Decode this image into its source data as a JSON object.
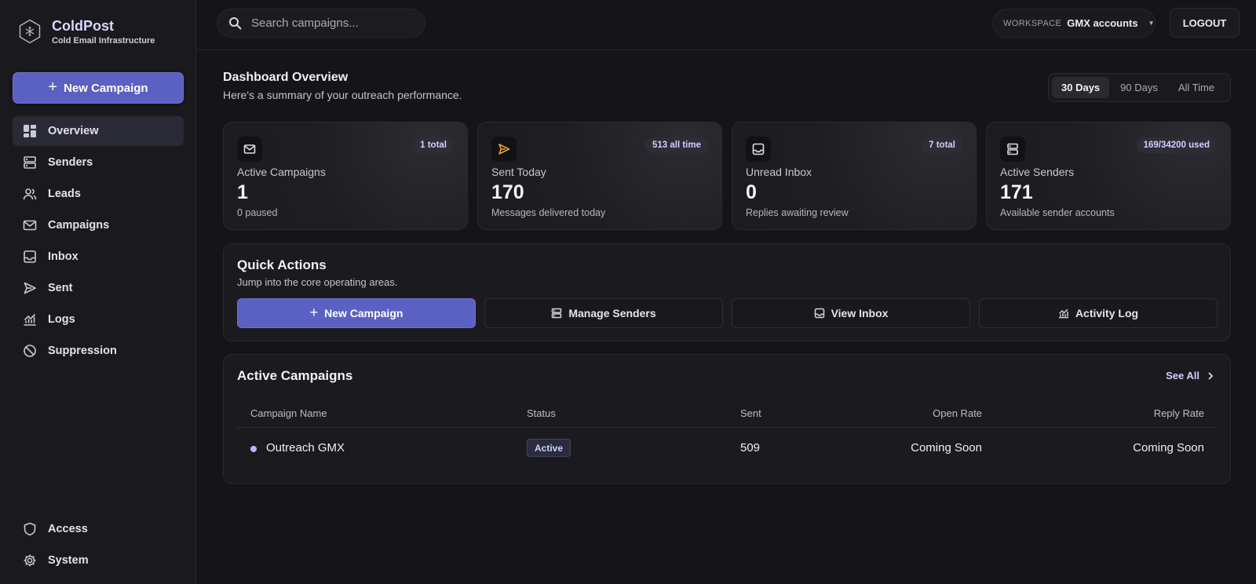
{
  "brand": {
    "title": "ColdPost",
    "subtitle": "Cold Email Infrastructure",
    "logo_icon": "hexagon-snowflake-icon",
    "accent_color": "#5b61c2"
  },
  "sidebar": {
    "new_campaign_label": "New Campaign",
    "items": [
      {
        "label": "Overview",
        "icon": "dashboard-icon",
        "active": true
      },
      {
        "label": "Senders",
        "icon": "server-icon"
      },
      {
        "label": "Leads",
        "icon": "users-icon"
      },
      {
        "label": "Campaigns",
        "icon": "mail-icon"
      },
      {
        "label": "Inbox",
        "icon": "inbox-icon"
      },
      {
        "label": "Sent",
        "icon": "send-icon"
      },
      {
        "label": "Logs",
        "icon": "chart-icon"
      },
      {
        "label": "Suppression",
        "icon": "ban-icon"
      }
    ],
    "bottom_items": [
      {
        "label": "Access",
        "icon": "shield-icon"
      },
      {
        "label": "System",
        "icon": "gear-icon"
      }
    ]
  },
  "header": {
    "search_placeholder": "Search campaigns...",
    "workspace_label": "WORKSPACE",
    "workspace_value": "GMX accounts",
    "logout_label": "LOGOUT"
  },
  "main": {
    "title": "Dashboard Overview",
    "subtitle": "Here's a summary of your outreach performance.",
    "ranges": [
      {
        "label": "30 Days",
        "active": true
      },
      {
        "label": "90 Days"
      },
      {
        "label": "All Time"
      }
    ],
    "stats": [
      {
        "label": "Active Campaigns",
        "value": "1",
        "sub": "0 paused",
        "badge": "1 total",
        "icon": "mail-icon"
      },
      {
        "label": "Sent Today",
        "value": "170",
        "sub": "Messages delivered today",
        "badge": "513 all time",
        "icon": "send-icon",
        "icon_color": "#f0a030"
      },
      {
        "label": "Unread Inbox",
        "value": "0",
        "sub": "Replies awaiting review",
        "badge": "7 total",
        "icon": "inbox-icon"
      },
      {
        "label": "Active Senders",
        "value": "171",
        "sub": "Available sender accounts",
        "badge": "169/34200 used",
        "icon": "server-icon"
      }
    ],
    "quick_actions": {
      "title": "Quick Actions",
      "subtitle": "Jump into the core operating areas.",
      "buttons": [
        {
          "label": "New Campaign",
          "icon": "plus-icon"
        },
        {
          "label": "Manage Senders",
          "icon": "server-icon"
        },
        {
          "label": "View Inbox",
          "icon": "inbox-icon"
        },
        {
          "label": "Activity Log",
          "icon": "chart-icon"
        }
      ]
    },
    "active_campaigns": {
      "title": "Active Campaigns",
      "see_all_label": "See All",
      "columns": [
        "Campaign Name",
        "Status",
        "Sent",
        "Open Rate",
        "Reply Rate"
      ],
      "rows": [
        {
          "name": "Outreach GMX",
          "status": "Active",
          "sent": "509",
          "open_rate": "Coming Soon",
          "reply_rate": "Coming Soon"
        }
      ]
    }
  }
}
